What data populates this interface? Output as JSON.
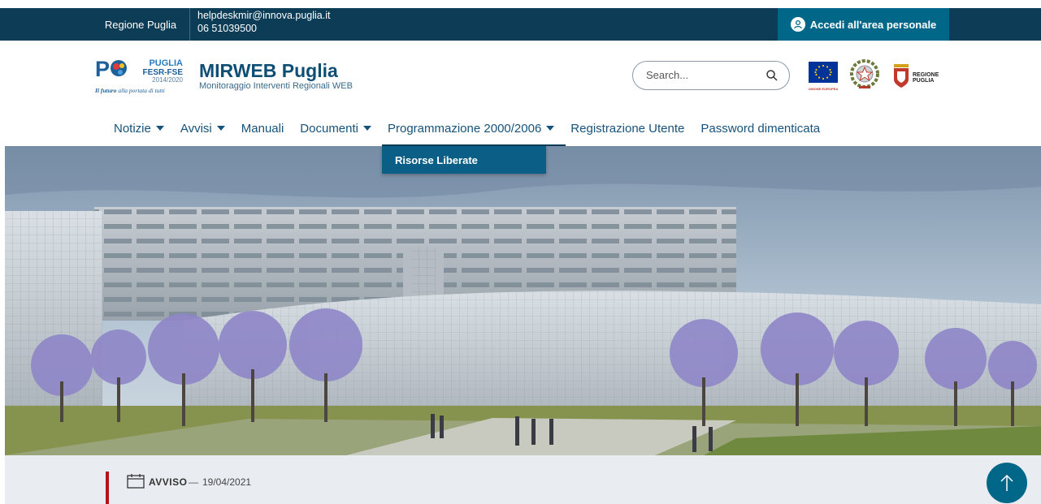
{
  "topbar": {
    "region_label": "Regione Puglia",
    "contact_email": "helpdeskmir@innova.puglia.it",
    "contact_phone": "06 51039500",
    "login_label": "Accedi all'area personale"
  },
  "header": {
    "site_title": "MIRWEB Puglia",
    "site_subtitle": "Monitoraggio Interventi Regionali WEB",
    "logo": {
      "mark": "P",
      "line1": "PUGLIA",
      "line2": "FESR-FSE",
      "line3": "2014/2020",
      "tagline_bold": "Il futuro",
      "tagline_rest": " alla portata di tutti"
    },
    "eu_label": "UNIONE EUROPEA",
    "region_logo_line1": "REGIONE",
    "region_logo_line2": "PUGLIA"
  },
  "search": {
    "placeholder": "Search..."
  },
  "nav": {
    "items": [
      {
        "label": "Notizie"
      },
      {
        "label": "Avvisi"
      },
      {
        "label": "Manuali"
      },
      {
        "label": "Documenti"
      },
      {
        "label": "Programmazione 2000/2006"
      },
      {
        "label": "Registrazione Utente"
      },
      {
        "label": "Password dimenticata"
      }
    ],
    "dropdown": {
      "items": [
        {
          "label": "Risorse Liberate"
        }
      ]
    }
  },
  "notice": {
    "type": "AVVISO",
    "separator": "—",
    "date": "19/04/2021"
  },
  "colors": {
    "topbar_bg": "#0d3d56",
    "login_bg": "#006788",
    "dropdown_bg": "#0b5f86",
    "accent_red": "#b5121b"
  }
}
